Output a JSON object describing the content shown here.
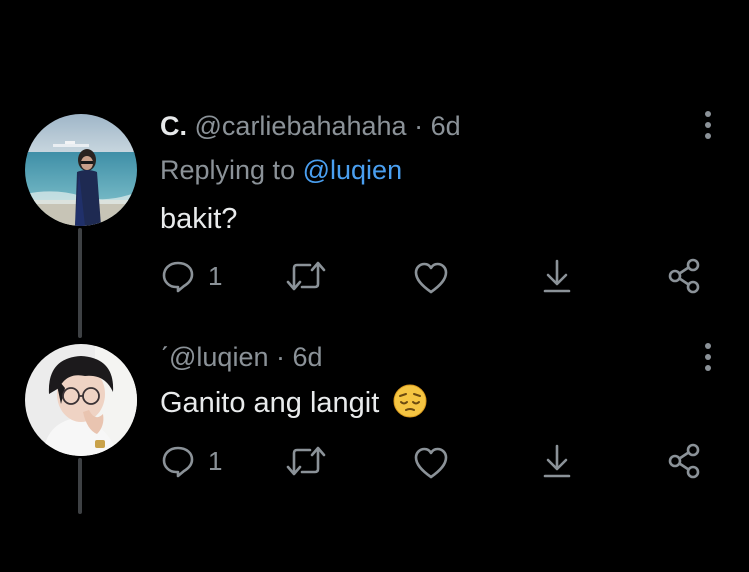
{
  "replies": [
    {
      "display_name": "C.",
      "handle": "@carliebahahaha",
      "separator": "·",
      "time": "6d",
      "replying_prefix": "Replying to",
      "replying_to": "@luqien",
      "text": "bakit?",
      "reply_count": "1",
      "avatar": "beach-photo-avatar"
    },
    {
      "display_name": "ˊ",
      "handle": "@luqien",
      "separator": "·",
      "time": "6d",
      "text": "Ganito ang langit",
      "emoji": "pensive-face-emoji",
      "reply_count": "1",
      "avatar": "person-with-glasses-avatar"
    }
  ],
  "colors": {
    "background": "#000000",
    "text": "#e7e9ea",
    "muted": "#8b9298",
    "link": "#4a9ff0",
    "thread_line": "#3e4144"
  }
}
